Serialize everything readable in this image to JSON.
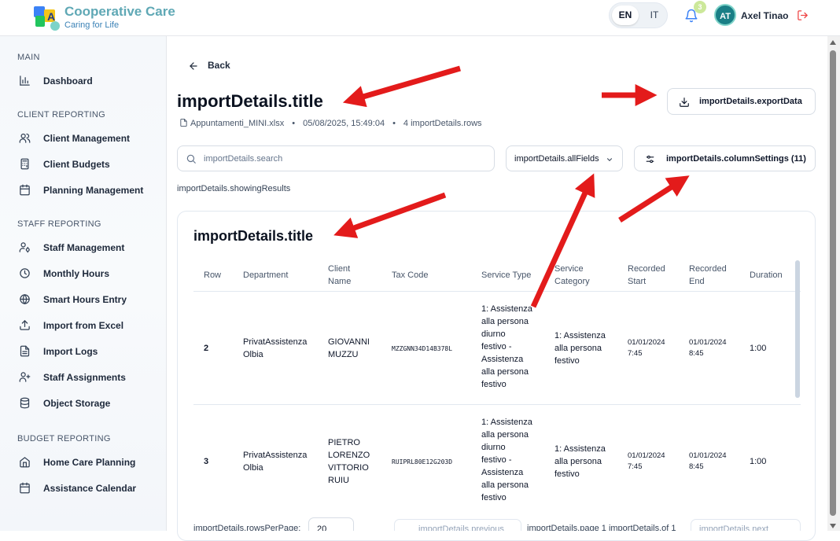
{
  "brand": {
    "title": "Cooperative Care",
    "subtitle": "Caring for Life"
  },
  "header": {
    "languages": [
      "EN",
      "IT"
    ],
    "active_language": "EN",
    "notification_count": "3",
    "user_initials": "AT",
    "user_name": "Axel Tinao",
    "icons": {
      "bell": "bell-icon",
      "logout": "logout-icon"
    }
  },
  "sidebar": {
    "sections": [
      {
        "title": "MAIN",
        "items": [
          {
            "label": "Dashboard",
            "icon": "bar-chart-icon"
          }
        ]
      },
      {
        "title": "CLIENT REPORTING",
        "items": [
          {
            "label": "Client Management",
            "icon": "users-icon"
          },
          {
            "label": "Client Budgets",
            "icon": "calculator-icon"
          },
          {
            "label": "Planning Management",
            "icon": "calendar-icon"
          }
        ]
      },
      {
        "title": "STAFF REPORTING",
        "items": [
          {
            "label": "Staff Management",
            "icon": "user-cog-icon"
          },
          {
            "label": "Monthly Hours",
            "icon": "clock-icon"
          },
          {
            "label": "Smart Hours Entry",
            "icon": "globe-icon"
          },
          {
            "label": "Import from Excel",
            "icon": "upload-icon"
          },
          {
            "label": "Import Logs",
            "icon": "file-text-icon"
          },
          {
            "label": "Staff Assignments",
            "icon": "user-plus-icon"
          },
          {
            "label": "Object Storage",
            "icon": "database-icon"
          }
        ]
      },
      {
        "title": "BUDGET REPORTING",
        "items": [
          {
            "label": "Home Care Planning",
            "icon": "home-icon"
          },
          {
            "label": "Assistance Calendar",
            "icon": "calendar-icon"
          }
        ]
      }
    ]
  },
  "page": {
    "back_label": "Back",
    "title": "importDetails.title",
    "file_name": "Appuntamenti_MINI.xlsx",
    "timestamp": "05/08/2025, 15:49:04",
    "rows_label": "4 importDetails.rows",
    "export_label": "importDetails.exportData",
    "search_placeholder": "importDetails.search",
    "field_filter": "importDetails.allFields",
    "column_settings": "importDetails.columnSettings (11)",
    "showing_results": "importDetails.showingResults"
  },
  "table": {
    "title": "importDetails.title",
    "columns": [
      {
        "label": "Row"
      },
      {
        "label": "Department"
      },
      {
        "label": "Client",
        "label2": "Name"
      },
      {
        "label": "Tax Code"
      },
      {
        "label": "Service Type"
      },
      {
        "label": "Service",
        "label2": "Category"
      },
      {
        "label": "Recorded",
        "label2": "Start"
      },
      {
        "label": "Recorded",
        "label2": "End"
      },
      {
        "label": "Duration"
      }
    ],
    "rows": [
      {
        "row": "2",
        "department": [
          "PrivatAssistenza",
          "Olbia"
        ],
        "client_name": [
          "GIOVANNI",
          "MUZZU"
        ],
        "tax_code": "MZZGNN34D14B378L",
        "service_type": [
          "1: Assistenza",
          "alla persona",
          "diurno",
          "festivo -",
          "Assistenza",
          "alla persona",
          "festivo"
        ],
        "service_category": [
          "1: Assistenza",
          "alla persona",
          "festivo"
        ],
        "recorded_start": [
          "01/01/2024",
          "7:45"
        ],
        "recorded_end": [
          "01/01/2024",
          "8:45"
        ],
        "duration": "1:00"
      },
      {
        "row": "3",
        "department": [
          "PrivatAssistenza",
          "Olbia"
        ],
        "client_name": [
          "PIETRO",
          "LORENZO",
          "VITTORIO",
          "RUIU"
        ],
        "tax_code": "RUIPRL80E12G203D",
        "service_type": [
          "1: Assistenza",
          "alla persona",
          "diurno",
          "festivo -",
          "Assistenza",
          "alla persona",
          "festivo"
        ],
        "service_category": [
          "1: Assistenza",
          "alla persona",
          "festivo"
        ],
        "recorded_start": [
          "01/01/2024",
          "7:45"
        ],
        "recorded_end": [
          "01/01/2024",
          "8:45"
        ],
        "duration": "1:00"
      }
    ]
  },
  "pagination": {
    "rows_per_page_label": "importDetails.rowsPerPage:",
    "rows_per_page_value": "20",
    "previous_label": "importDetails.previous",
    "page_info": "importDetails.page 1 importDetails.of 1",
    "next_label": "importDetails.next"
  },
  "annotations": {
    "arrow_color": "#e31b1b",
    "arrow_count": 6
  }
}
